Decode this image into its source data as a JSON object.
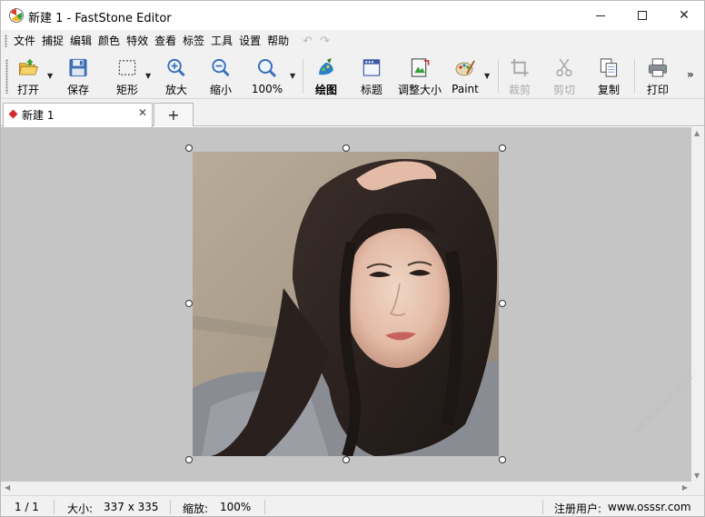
{
  "window": {
    "title": "新建 1 - FastStone Editor",
    "minimize_icon": "minimize-icon",
    "maximize_icon": "maximize-icon",
    "close_label": "✕"
  },
  "menu": {
    "items": [
      "文件",
      "捕捉",
      "编辑",
      "颜色",
      "特效",
      "查看",
      "标签",
      "工具",
      "设置",
      "帮助"
    ],
    "undo": "↶",
    "redo": "↷"
  },
  "toolbar": {
    "open": "打开",
    "save": "保存",
    "rect": "矩形",
    "zoom_in": "放大",
    "zoom_out": "缩小",
    "zoom_level": "100%",
    "draw": "绘图",
    "caption": "标题",
    "resize": "调整大小",
    "paint": "Paint",
    "crop": "裁剪",
    "cut": "剪切",
    "copy": "复制",
    "print": "打印",
    "more": "»"
  },
  "tabs": {
    "doc_tab_label": "新建 1",
    "close": "✕",
    "add": "+"
  },
  "status": {
    "page": "1 / 1",
    "size_label": "大小:",
    "size_value": "337 x 335",
    "zoom_label": "缩放:",
    "zoom_value": "100%",
    "registered_label": "注册用户:",
    "registered_value": "www.osssr.com"
  },
  "watermark": "www.osssr.com",
  "colors": {
    "canvas_bg": "#c5c5c5",
    "chrome_bg": "#f1f1f1",
    "accent_red": "#d42a2a"
  }
}
